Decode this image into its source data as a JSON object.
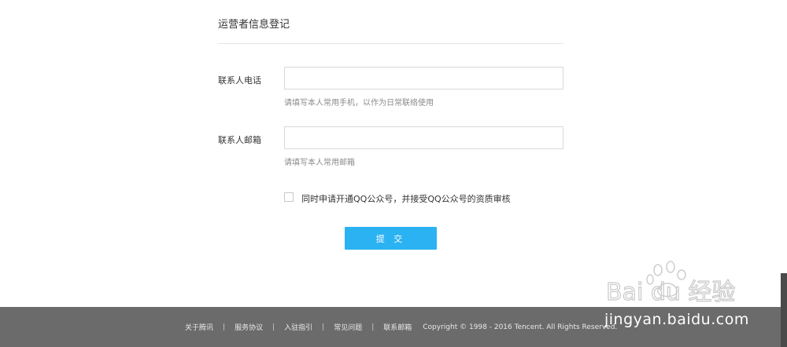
{
  "section": {
    "title": "运营者信息登记"
  },
  "form": {
    "phone": {
      "label": "联系人电话",
      "value": "",
      "hint": "请填写本人常用手机，以作为日常联络使用"
    },
    "email": {
      "label": "联系人邮箱",
      "value": "",
      "hint": "请填写本人常用邮箱"
    },
    "agreement": {
      "label": "同时申请开通QQ公众号，并接受QQ公众号的资质审核",
      "checked": false
    },
    "submit_label": "提 交"
  },
  "footer": {
    "links": [
      "关于腾讯",
      "服务协议",
      "入驻指引",
      "常见问题",
      "联系邮箱"
    ],
    "copyright": "Copyright © 1998 - 2016 Tencent. All Rights Reserved."
  },
  "watermark": {
    "brand_text": "Bai du 经验",
    "url_text": "jingyan.baidu.com"
  },
  "colors": {
    "accent": "#2bb2f2",
    "footer_bg": "#6b6b6b"
  }
}
